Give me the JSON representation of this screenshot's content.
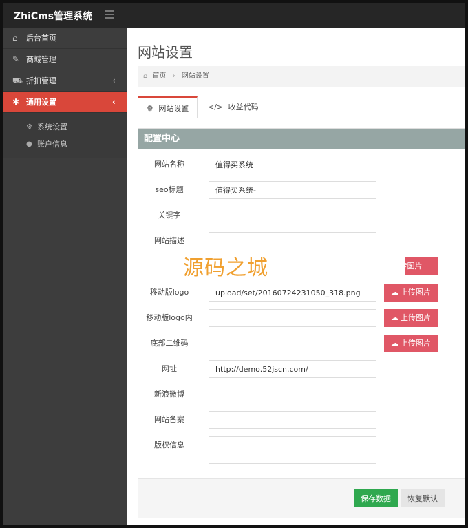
{
  "app": {
    "title": "ZhiCms管理系统"
  },
  "sidebar": {
    "items": [
      {
        "icon": "home-icon",
        "glyph": "⌂",
        "label": "后台首页",
        "caret": ""
      },
      {
        "icon": "magic-wand-icon",
        "glyph": "✎",
        "label": "商城管理",
        "caret": ""
      },
      {
        "icon": "cart-icon",
        "glyph": "⛟",
        "label": "折扣管理",
        "caret": "‹"
      },
      {
        "icon": "gear-icon",
        "glyph": "✱",
        "label": "通用设置",
        "caret": "‹"
      }
    ],
    "subitems": [
      {
        "icon": "gears-icon",
        "glyph": "⚙",
        "label": "系统设置"
      },
      {
        "icon": "user-icon",
        "glyph": "●",
        "label": "账户信息"
      }
    ]
  },
  "page": {
    "title": "网站设置",
    "breadcrumb": {
      "home": "首页",
      "separator": "›",
      "current": "网站设置"
    }
  },
  "tabs": [
    {
      "label": "网站设置",
      "glyph": "⚙"
    },
    {
      "label": "收益代码",
      "glyph": "</>"
    }
  ],
  "panel": {
    "title": "配置中心",
    "fields": {
      "site_name": {
        "label": "网站名称",
        "value": "值得买系统"
      },
      "seo_title": {
        "label": "seo标题",
        "value": "值得买系统-"
      },
      "keywords": {
        "label": "关键字",
        "value": ""
      },
      "description": {
        "label": "网站描述",
        "value": ""
      },
      "mobile_logo": {
        "label": "移动版logo",
        "value": "upload/set/20160724231050_318.png"
      },
      "mobile_logo_inner": {
        "label": "移动版logo内",
        "value": ""
      },
      "footer_qr": {
        "label": "底部二维码",
        "value": ""
      },
      "url": {
        "label": "网址",
        "value": "http://demo.52jscn.com/"
      },
      "weibo": {
        "label": "新浪微博",
        "value": ""
      },
      "icp": {
        "label": "网站备案",
        "value": ""
      },
      "copyright": {
        "label": "版权信息",
        "value": ""
      }
    },
    "upload_label": "上传图片",
    "upload_partial_label": "传图片",
    "save_label": "保存数据",
    "reset_label": "恢复默认"
  },
  "watermark": {
    "text": "源码之城"
  },
  "colors": {
    "accent": "#d9473a",
    "upload": "#e05766",
    "save": "#2fa84f",
    "panel_header": "#96a6a4",
    "watermark": "#f0a030"
  }
}
